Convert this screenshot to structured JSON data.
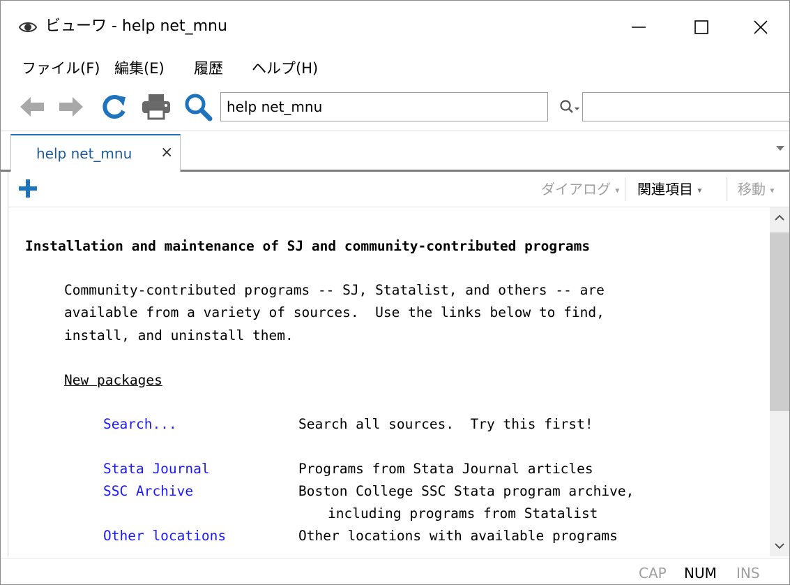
{
  "window": {
    "title": "ビューワ - help net_mnu",
    "eye_icon": "eye-icon",
    "controls": {
      "minimize": "minimize-icon",
      "maximize": "maximize-icon",
      "close": "close-icon"
    }
  },
  "menu": {
    "items": [
      {
        "label": "ファイル(F)"
      },
      {
        "label": "編集(E)"
      },
      {
        "label": "履歴"
      },
      {
        "label": "ヘルプ(H)"
      }
    ]
  },
  "toolbar": {
    "icons": [
      "back-arrow-icon",
      "forward-arrow-icon",
      "refresh-icon",
      "print-icon",
      "search-icon"
    ],
    "address_value": "help net_mnu",
    "find_value": ""
  },
  "tabs": [
    {
      "label": "help net_mnu",
      "close": "×"
    }
  ],
  "subbar": {
    "dialog_label": "ダイアログ",
    "related_label": "関連項目",
    "move_label": "移動"
  },
  "content": {
    "heading": "Installation and maintenance of SJ and community-contributed programs",
    "intro": [
      "Community-contributed programs -- SJ, Statalist, and others -- are",
      "available from a variety of sources.  Use the links below to find,",
      "install, and uninstall them."
    ],
    "section_title": "New packages",
    "links": [
      {
        "link": "Search...",
        "desc": "Search all sources.  Try this first!"
      },
      {
        "link": "Stata Journal",
        "desc": "Programs from Stata Journal articles"
      },
      {
        "link": "SSC Archive",
        "desc": "Boston College SSC Stata program archive,",
        "desc2": "including programs from Statalist"
      },
      {
        "link": "Other locations",
        "desc": "Other locations with available programs"
      }
    ]
  },
  "status": {
    "cap": "CAP",
    "num": "NUM",
    "ins": "INS"
  },
  "colors": {
    "accent": "#1e73be",
    "link": "#1a1aff",
    "disabled": "#a0a0a0"
  }
}
